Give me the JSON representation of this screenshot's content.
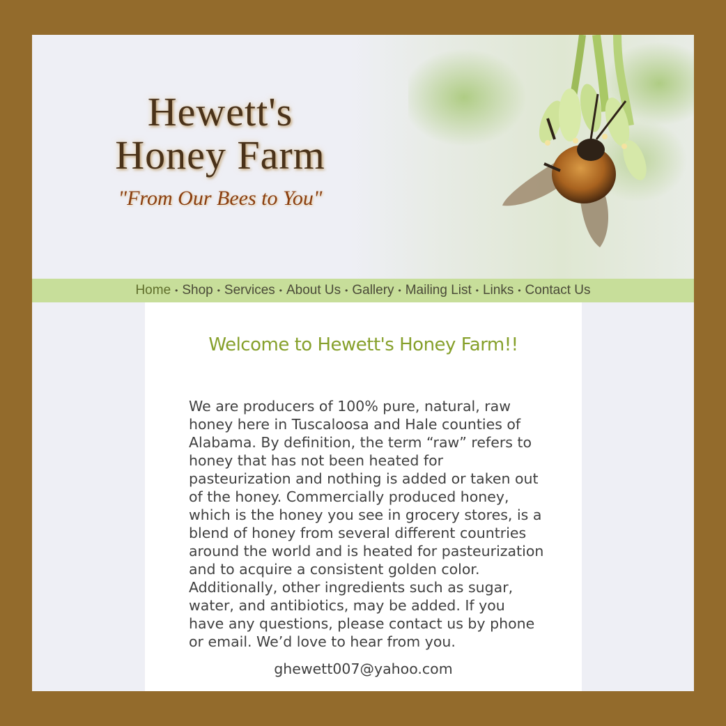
{
  "header": {
    "brand_line1": "Hewett's",
    "brand_line2": "Honey Farm",
    "slogan": "\"From Our Bees to You\"",
    "photo_icon": "bee-on-flower-photo"
  },
  "nav": {
    "items": [
      "Home",
      "Shop",
      "Services",
      "About Us",
      "Gallery",
      "Mailing List",
      "Links",
      "Contact Us"
    ],
    "separator": "•",
    "active": "Home"
  },
  "main": {
    "heading": "Welcome to Hewett's Honey Farm!!",
    "intro": "We are producers of 100% pure, natural, raw honey here in Tuscaloosa and Hale counties of Alabama. By definition, the term “raw” refers to honey that has not been heated for pasteurization and nothing is added or taken out of the honey. Commercially produced honey, which is the honey you see in grocery stores, is a blend of honey from several different countries around the world and is heated for pasteurization and to acquire a consistent golden color. Additionally, other ingredients such as sugar, water, and antibiotics, may be added. If you have any questions, please contact us by phone or email. We’d love to hear from you.",
    "email": "ghewett007@yahoo.com"
  },
  "colors": {
    "frame": "#936b2c",
    "nav_bg": "#c7de9a",
    "heading": "#86a02b",
    "brand": "#4a3219",
    "slogan": "#8a3e0f"
  }
}
